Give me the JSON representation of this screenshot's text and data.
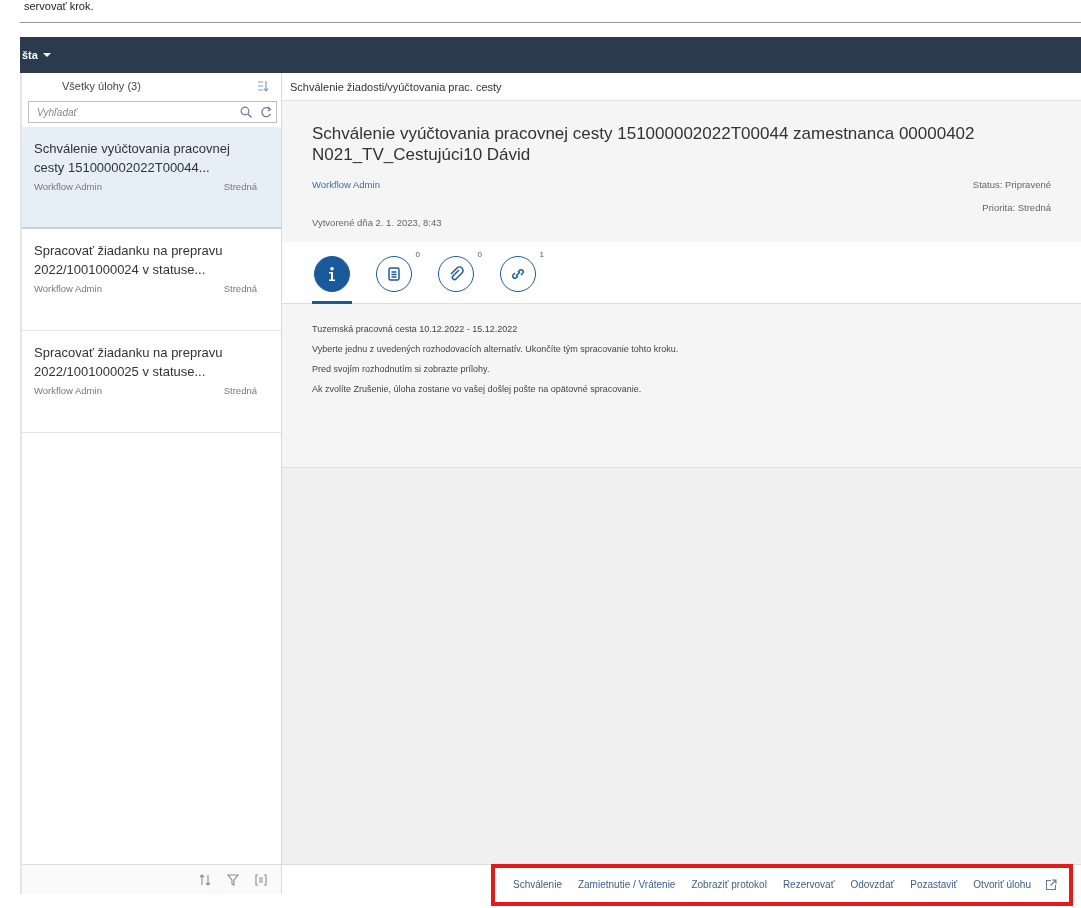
{
  "caption": "servovať krok.",
  "shell_bar": {
    "title": "šta"
  },
  "master": {
    "title": "Všetky úlohy (3)",
    "search": {
      "placeholder": "Vyhľadať"
    },
    "items": [
      {
        "title": "Schválenie vyúčtovania pracovnej cesty 151000002022T00044...",
        "creator": "Workflow Admin",
        "priority": "Stredná",
        "selected": true
      },
      {
        "title": "Spracovať žiadanku na prepravu 2022/1001000024 v statuse...",
        "creator": "Workflow Admin",
        "priority": "Stredná",
        "selected": false
      },
      {
        "title": "Spracovať žiadanku na prepravu 2022/1001000025 v statuse...",
        "creator": "Workflow Admin",
        "priority": "Stredná",
        "selected": false
      }
    ]
  },
  "detail": {
    "page_title": "Schválenie žiadosti/vyúčtovania prac. cesty",
    "header": {
      "title": "Schválenie vyúčtovania pracovnej cesty 151000002022T00044 zamestnanca 00000402 N021_TV_Cestujúci10 Dávid",
      "creator": "Workflow Admin",
      "status": "Status: Pripravené",
      "priority": "Priorita: Stredná",
      "created": "Vytvorené dňa 2. 1. 2023, 8:43"
    },
    "tabs": [
      {
        "kind": "info",
        "selected": true
      },
      {
        "kind": "notes",
        "count": "0",
        "selected": false
      },
      {
        "kind": "attachments",
        "count": "0",
        "selected": false
      },
      {
        "kind": "links",
        "count": "1",
        "selected": false
      }
    ],
    "description": [
      "Tuzemská pracovná cesta 10.12.2022 - 15.12.2022",
      "Vyberte jednu z uvedených rozhodovacích alternatív. Ukončíte tým spracovanie tohto kroku.",
      "Pred svojím rozhodnutím si zobrazte prílohy.",
      "Ak zvolíte Zrušenie, úloha zostane vo vašej došlej pošte na opätovné spracovanie."
    ],
    "actions": [
      "Schválenie",
      "Zamietnutie / Vrátenie",
      "Zobraziť protokol",
      "Rezervovať",
      "Odovzdať",
      "Pozastaviť",
      "Otvoriť úlohu"
    ],
    "highlighted": true
  }
}
